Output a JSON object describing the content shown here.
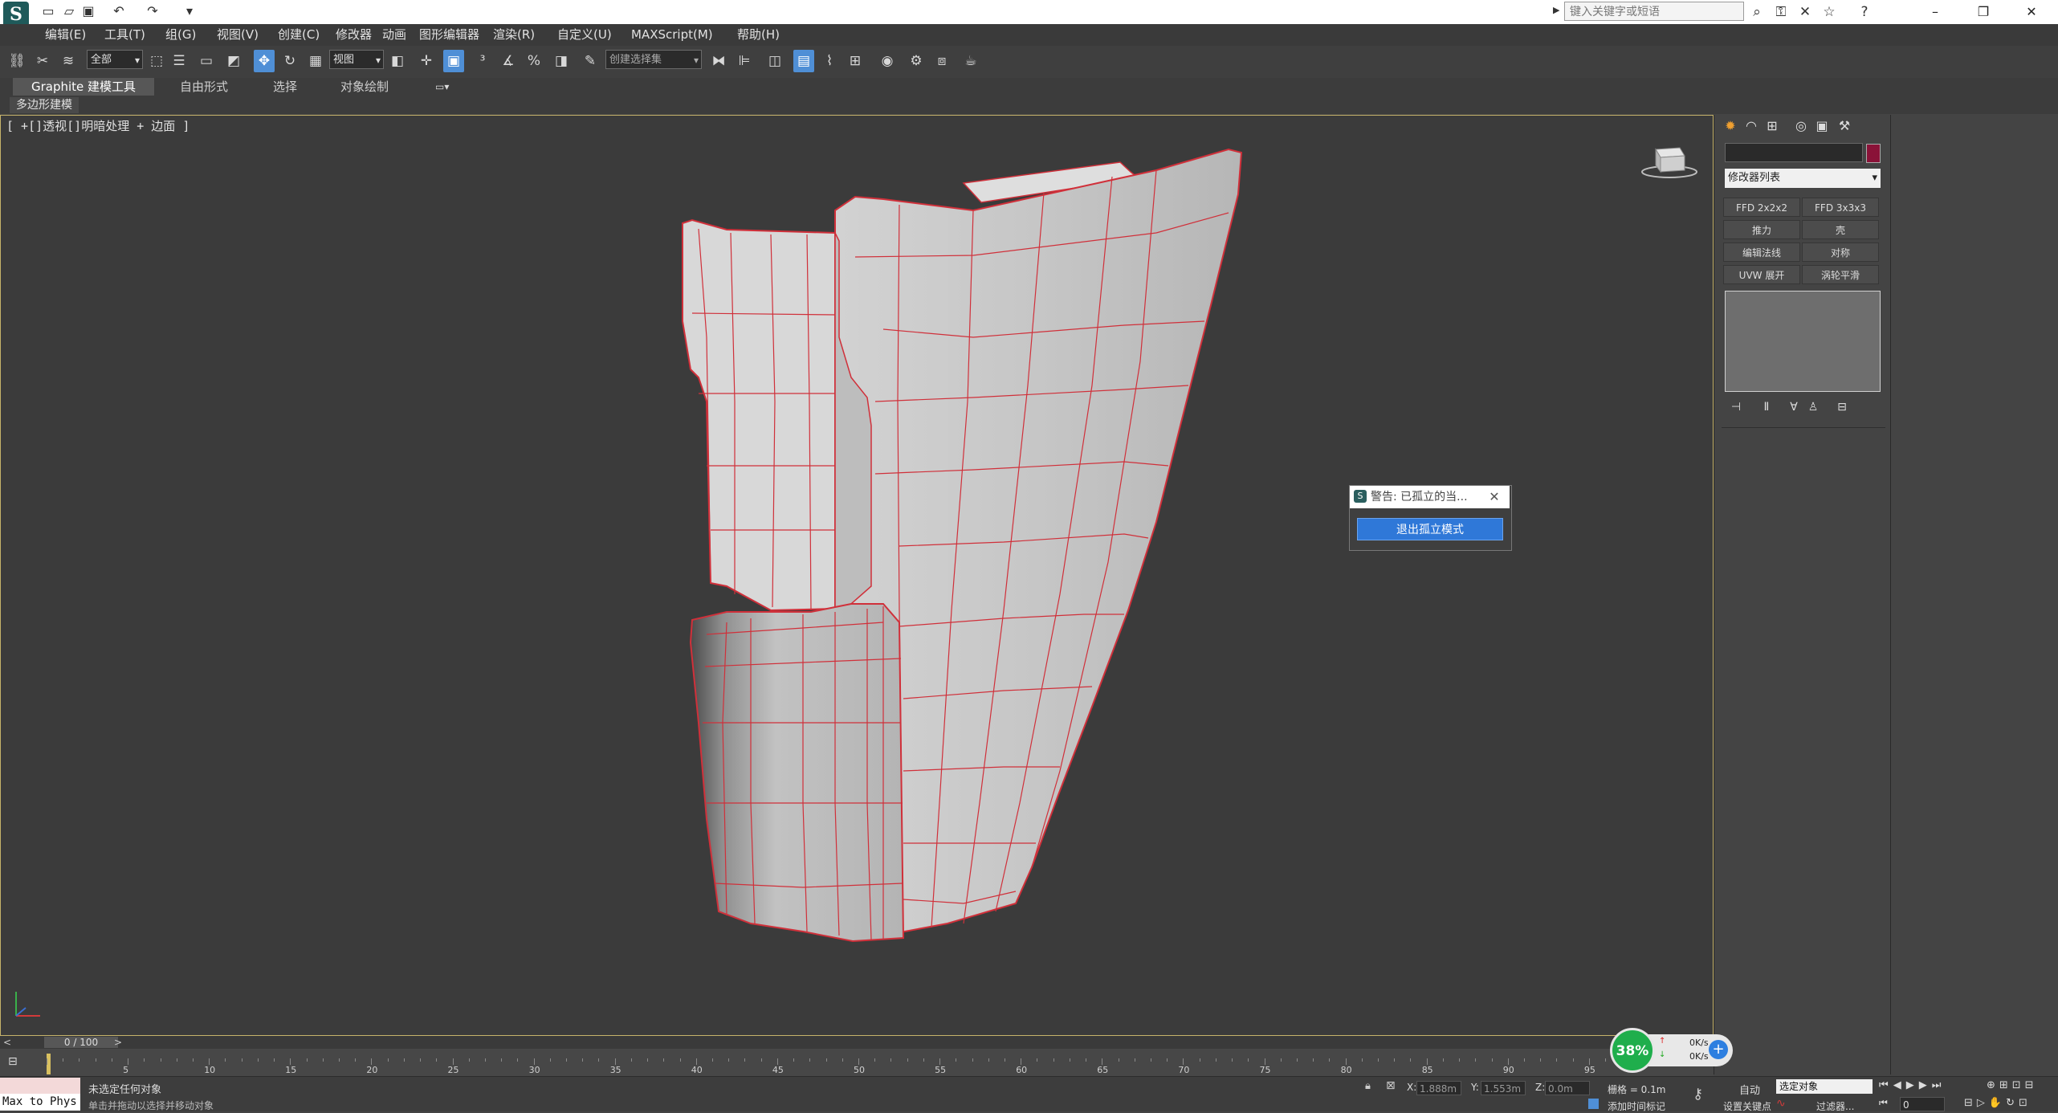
{
  "quick_access": {
    "logo": "S",
    "icons": [
      "new-icon",
      "open-icon",
      "save-icon",
      "undo-icon",
      "redo-icon",
      "customize-icon"
    ]
  },
  "title_search": {
    "placeholder": "键入关键字或短语"
  },
  "menu": [
    "编辑(E)",
    "工具(T)",
    "组(G)",
    "视图(V)",
    "创建(C)",
    "修改器",
    "动画",
    "图形编辑器",
    "渲染(R)",
    "自定义(U)",
    "MAXScript(M)",
    "帮助(H)"
  ],
  "toolbar": {
    "selection_filter": "全部",
    "ref_coord": "视图",
    "named_selection": "创建选择集"
  },
  "ribbon": {
    "tabs": [
      "Graphite 建模工具",
      "自由形式",
      "选择",
      "对象绘制"
    ],
    "subtab": "多边形建模"
  },
  "viewport": {
    "label": "[ +[]透视[]明暗处理 + 边面 ]",
    "wire_color": "#d0303a"
  },
  "dialog": {
    "title": "警告: 已孤立的当...",
    "button": "退出孤立模式"
  },
  "command_panel": {
    "modifier_list": "修改器列表",
    "color_swatch": "#8a1238",
    "buttons": [
      "FFD 2x2x2",
      "FFD 3x3x3",
      "推力",
      "壳",
      "编辑法线",
      "对称",
      "UVW 展开",
      "涡轮平滑"
    ]
  },
  "timeline": {
    "frame": "0 / 100",
    "ticks": [
      "5",
      "10",
      "15",
      "20",
      "25",
      "30",
      "35",
      "40",
      "45",
      "50",
      "55",
      "60",
      "65",
      "70",
      "75",
      "80",
      "85",
      "90",
      "95"
    ]
  },
  "status": {
    "listener": "Max to Phys",
    "line1": "未选定任何对象",
    "line2": "单击并拖动以选择并移动对象",
    "x": "1.888m",
    "y": "1.553m",
    "z": "0.0m",
    "grid": "栅格 = 0.1m",
    "add_time_tag": "添加时间标记",
    "auto": "自动",
    "selected": "选定对象",
    "set_key": "设置关键点",
    "filter": "过滤器...",
    "frame_field": "0"
  },
  "net_widget": {
    "percent": "38%",
    "up": "0K/s",
    "down": "0K/s"
  }
}
